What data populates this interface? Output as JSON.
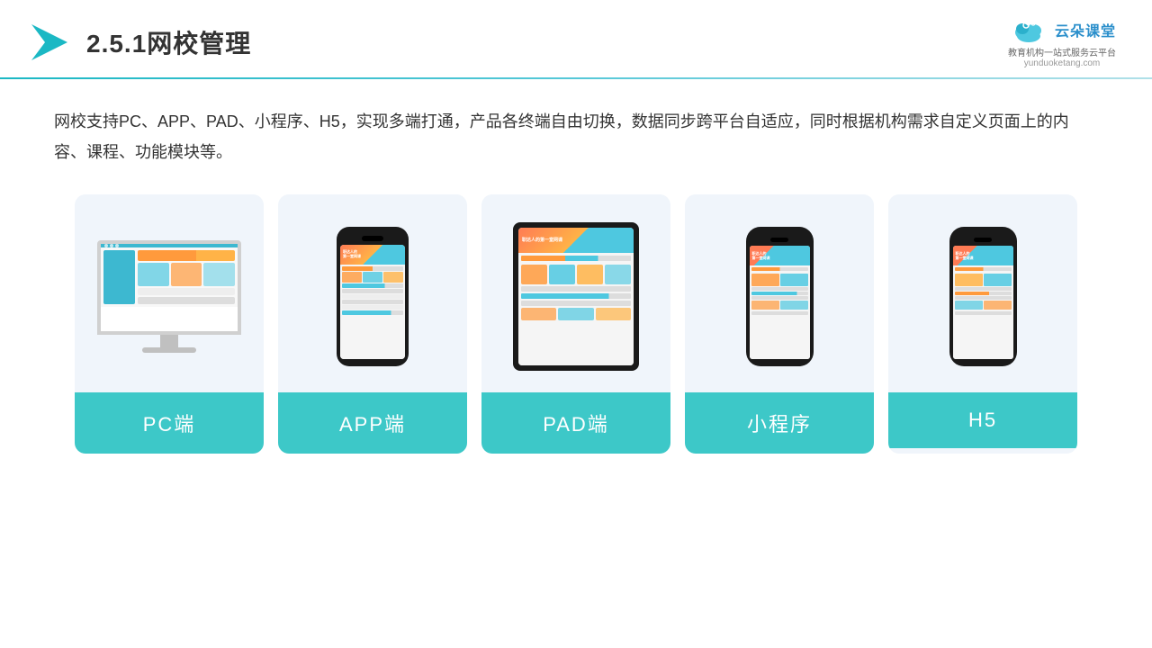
{
  "header": {
    "title": "2.5.1网校管理",
    "brand_name": "云朵课堂",
    "brand_tagline": "教育机构一站\n式服务云平台",
    "brand_url": "yunduoketang.com"
  },
  "description": "网校支持PC、APP、PAD、小程序、H5，实现多端打通，产品各终端自由切换，数据同步跨平台自适应，同时根据机构需求自定义页面上的内容、课程、功能模块等。",
  "cards": [
    {
      "id": "pc",
      "label": "PC端"
    },
    {
      "id": "app",
      "label": "APP端"
    },
    {
      "id": "pad",
      "label": "PAD端"
    },
    {
      "id": "miniapp",
      "label": "小程序"
    },
    {
      "id": "h5",
      "label": "H5"
    }
  ]
}
